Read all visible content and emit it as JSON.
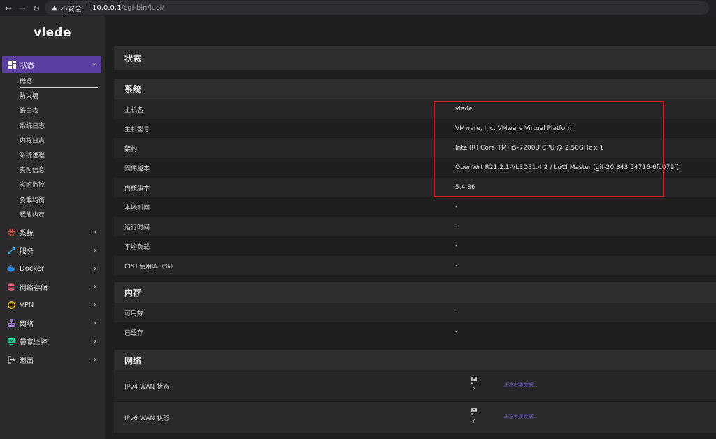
{
  "browser": {
    "insecure_label": "不安全",
    "url_host": "10.0.0.1",
    "url_path": "/cgi-bin/luci/"
  },
  "sidebar": {
    "logo": "vlede",
    "active_menu": {
      "label": "状态",
      "icon": "dashboard-icon"
    },
    "submenu": [
      "概览",
      "防火墙",
      "路由表",
      "系统日志",
      "内核日志",
      "系统进程",
      "实时信息",
      "实时监控",
      "负载均衡",
      "释放内存"
    ],
    "menu": [
      {
        "label": "系统",
        "icon": "gear-icon",
        "color": "#e8483c"
      },
      {
        "label": "服务",
        "icon": "share-icon",
        "color": "#3ba0e6"
      },
      {
        "label": "Docker",
        "icon": "docker-icon",
        "color": "#2e8de6"
      },
      {
        "label": "网络存储",
        "icon": "database-icon",
        "color": "#e05a7a"
      },
      {
        "label": "VPN",
        "icon": "globe-icon",
        "color": "#f0c020"
      },
      {
        "label": "网络",
        "icon": "sitemap-icon",
        "color": "#9b6fe0"
      },
      {
        "label": "带宽监控",
        "icon": "monitor-icon",
        "color": "#2fcf9a"
      },
      {
        "label": "退出",
        "icon": "logout-icon",
        "color": "#ccc"
      }
    ]
  },
  "main": {
    "page_title": "状态",
    "system": {
      "title": "系统",
      "rows": [
        {
          "label": "主机名",
          "value": "vlede"
        },
        {
          "label": "主机型号",
          "value": "VMware, Inc. VMware Virtual Platform"
        },
        {
          "label": "架构",
          "value": "Intel(R) Core(TM) i5-7200U CPU @ 2.50GHz x 1"
        },
        {
          "label": "固件版本",
          "value": "OpenWrt R21.2.1-VLEDE1.4.2 / LuCI Master (git-20.343.54716-6fc079f)"
        },
        {
          "label": "内核版本",
          "value": "5.4.86"
        },
        {
          "label": "本地时间",
          "value": "-"
        },
        {
          "label": "运行时间",
          "value": "-"
        },
        {
          "label": "平均负载",
          "value": "-"
        },
        {
          "label": "CPU 使用率（%）",
          "value": "-"
        }
      ]
    },
    "memory": {
      "title": "内存",
      "rows": [
        {
          "label": "可用数",
          "value": "-"
        },
        {
          "label": "已缓存",
          "value": "-"
        }
      ]
    },
    "network": {
      "title": "网络",
      "rows": [
        {
          "label": "IPv4 WAN 状态",
          "q": "?",
          "status": "正在收集数据..."
        },
        {
          "label": "IPv6 WAN 状态",
          "q": "?",
          "status": "正在收集数据..."
        }
      ]
    }
  }
}
